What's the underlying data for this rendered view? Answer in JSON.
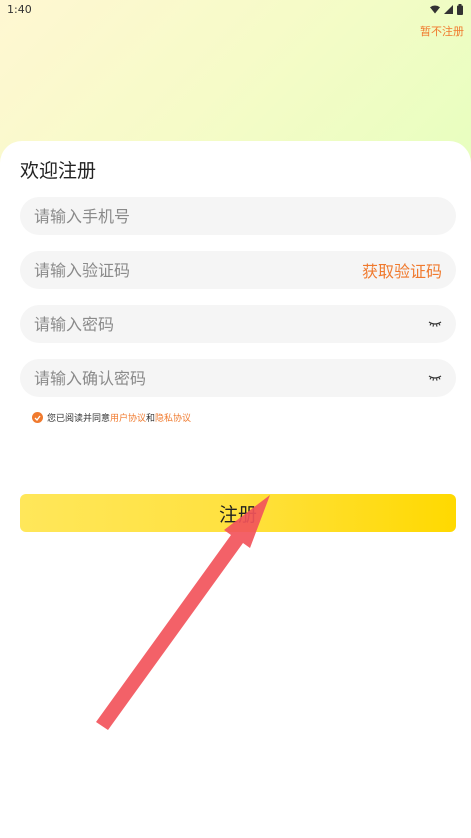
{
  "status_bar": {
    "time": "1:40",
    "icons": [
      "wifi-icon",
      "signal-icon",
      "battery-icon"
    ]
  },
  "header": {
    "skip_label": "暂不注册"
  },
  "form": {
    "title": "欢迎注册",
    "phone_placeholder": "请输入手机号",
    "code_placeholder": "请输入验证码",
    "get_code_label": "获取验证码",
    "password_placeholder": "请输入密码",
    "confirm_placeholder": "请输入确认密码",
    "agreement": {
      "prefix": "您已阅读并同意",
      "user_agreement": "用户协议",
      "conjunction": "和",
      "privacy_policy": "隐私协议",
      "checked": true
    },
    "submit_label": "注册"
  },
  "colors": {
    "accent": "#f07a2e",
    "button_start": "#ffe75a",
    "button_end": "#ffd900",
    "arrow": "#f2545b"
  }
}
